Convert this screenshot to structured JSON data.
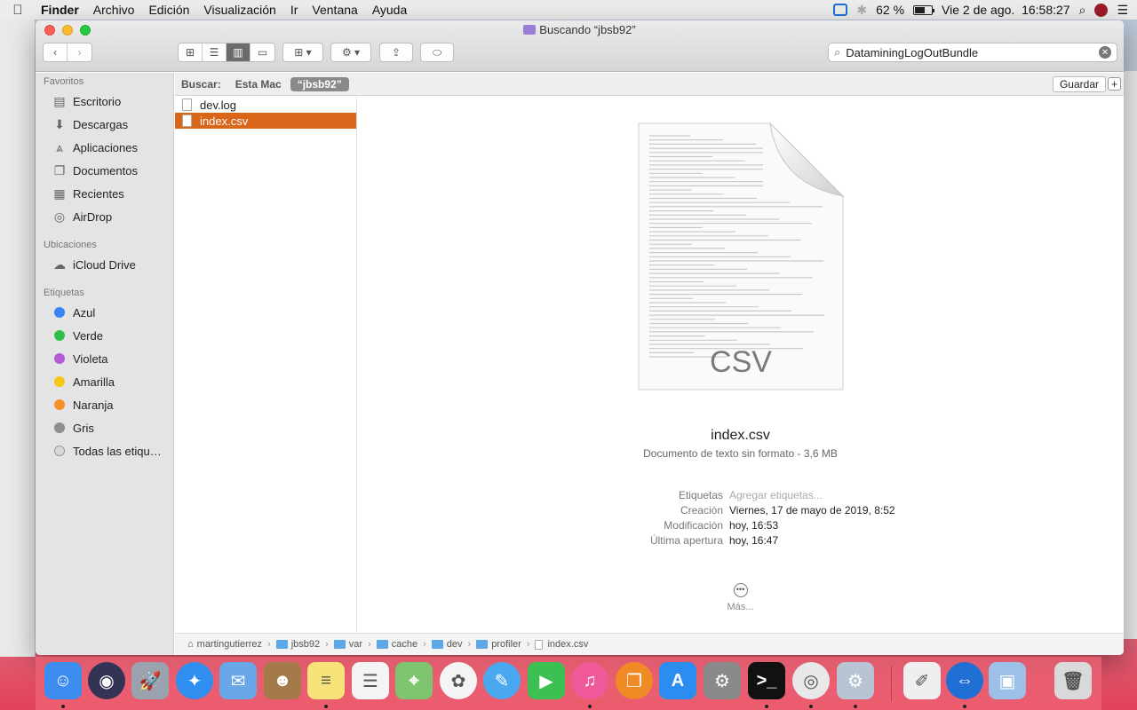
{
  "menubar": {
    "app": "Finder",
    "items": [
      "Archivo",
      "Edición",
      "Visualización",
      "Ir",
      "Ventana",
      "Ayuda"
    ],
    "battery_text": "62 %",
    "battery_level": 0.62,
    "clock": "Vie 2 de ago.  16:58:27"
  },
  "window": {
    "title": "Buscando “jbsb92”",
    "search_value": "DataminingLogOutBundle"
  },
  "sidebar": {
    "favorites_header": "Favoritos",
    "favorites": [
      {
        "label": "Escritorio",
        "icon": "desktop-icon"
      },
      {
        "label": "Descargas",
        "icon": "download-icon"
      },
      {
        "label": "Aplicaciones",
        "icon": "applications-icon"
      },
      {
        "label": "Documentos",
        "icon": "documents-icon"
      },
      {
        "label": "Recientes",
        "icon": "recents-icon"
      },
      {
        "label": "AirDrop",
        "icon": "airdrop-icon"
      }
    ],
    "locations_header": "Ubicaciones",
    "locations": [
      {
        "label": "iCloud Drive",
        "icon": "cloud-icon"
      }
    ],
    "tags_header": "Etiquetas",
    "tags": [
      {
        "label": "Azul",
        "color": "#3b82f6"
      },
      {
        "label": "Verde",
        "color": "#2fbf4a"
      },
      {
        "label": "Violeta",
        "color": "#b45ad6"
      },
      {
        "label": "Amarilla",
        "color": "#f5c518"
      },
      {
        "label": "Naranja",
        "color": "#f5902a"
      },
      {
        "label": "Gris",
        "color": "#8e8e8e"
      },
      {
        "label": "Todas las etiqu…",
        "color": "#d8d8d8"
      }
    ]
  },
  "scope": {
    "label": "Buscar:",
    "this_mac": "Esta Mac",
    "query": "“jbsb92”",
    "save": "Guardar",
    "add": "+"
  },
  "files": [
    "dev.log",
    "index.csv"
  ],
  "selected_index": 1,
  "preview": {
    "thumb_text": "CSV",
    "name": "index.csv",
    "kind": "Documento de texto sin formato - 3,6 MB",
    "meta": [
      {
        "key": "Etiquetas",
        "value": "Agregar etiquetas..."
      },
      {
        "key": "Creación",
        "value": "Viernes, 17 de mayo de 2019, 8:52"
      },
      {
        "key": "Modificación",
        "value": "hoy, 16:53"
      },
      {
        "key": "Última apertura",
        "value": "hoy, 16:47"
      }
    ],
    "more": "Más..."
  },
  "pathbar": [
    "martingutierrez",
    "jbsb92",
    "var",
    "cache",
    "dev",
    "profiler",
    "index.csv"
  ],
  "dock": [
    {
      "name": "finder",
      "color": "#3d8df0",
      "glyph": "☺",
      "running": true
    },
    {
      "name": "siri",
      "color": "#333355",
      "glyph": "◉",
      "running": false
    },
    {
      "name": "launchpad",
      "color": "#9aa3ad",
      "glyph": "🚀",
      "running": false
    },
    {
      "name": "safari",
      "color": "#2f8ef0",
      "glyph": "✦",
      "running": false
    },
    {
      "name": "mail",
      "color": "#6aa7e8",
      "glyph": "✉",
      "running": false
    },
    {
      "name": "contacts",
      "color": "#a47a4b",
      "glyph": "☻",
      "running": false
    },
    {
      "name": "notes",
      "color": "#f8e27a",
      "glyph": "≡",
      "running": true
    },
    {
      "name": "reminders",
      "color": "#f4f4f4",
      "glyph": "☰",
      "running": false
    },
    {
      "name": "maps",
      "color": "#7fc46f",
      "glyph": "⌖",
      "running": false
    },
    {
      "name": "photos",
      "color": "#f4f4f4",
      "glyph": "✿",
      "running": false
    },
    {
      "name": "messages",
      "color": "#4aa8f0",
      "glyph": "✎",
      "running": false
    },
    {
      "name": "facetime",
      "color": "#3cc052",
      "glyph": "▶",
      "running": false
    },
    {
      "name": "itunes",
      "color": "#f05a9a",
      "glyph": "♫",
      "running": true
    },
    {
      "name": "books",
      "color": "#f08a24",
      "glyph": "❐",
      "running": false
    },
    {
      "name": "app-store",
      "color": "#2b8df0",
      "glyph": "A",
      "running": false
    },
    {
      "name": "system-preferences",
      "color": "#8a8a8a",
      "glyph": "⚙",
      "running": false
    },
    {
      "name": "terminal",
      "color": "#111111",
      "glyph": ">_",
      "running": true
    },
    {
      "name": "chrome",
      "color": "#e8e8e8",
      "glyph": "◎",
      "running": true
    },
    {
      "name": "utility-app",
      "color": "#b8c4d4",
      "glyph": "⚙",
      "running": true
    },
    {
      "name": "textedit",
      "color": "#efefef",
      "glyph": "✐",
      "running": false
    },
    {
      "name": "teamviewer",
      "color": "#1f6fd4",
      "glyph": "⇔",
      "running": true
    },
    {
      "name": "virtualbox",
      "color": "#9cc0e8",
      "glyph": "▣",
      "running": false
    },
    {
      "name": "trash",
      "color": "#d9d9d9",
      "glyph": "🗑",
      "running": false
    }
  ]
}
